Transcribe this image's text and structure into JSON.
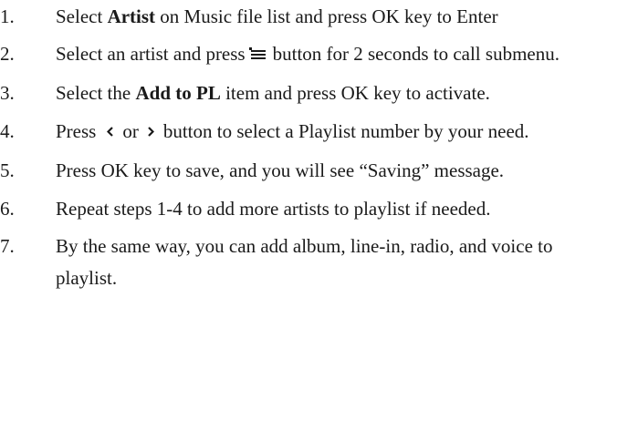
{
  "steps": [
    {
      "number": "1.",
      "before": "Select ",
      "bold": "Artist",
      "after": " on Music file list and press OK key to Enter"
    },
    {
      "number": "2.",
      "before": "Select an artist and press",
      "icon": "menu-list-icon",
      "after": "button for 2 seconds to call submenu."
    },
    {
      "number": "3.",
      "before": "Select the ",
      "bold": "Add to PL",
      "after": " item and press OK key to activate."
    },
    {
      "number": "4.",
      "before": "Press",
      "icon_left": "chevron-left-icon",
      "middle": "or",
      "icon_right": "chevron-right-icon",
      "after": "button to select a Playlist number by your need."
    },
    {
      "number": "5.",
      "text": "Press OK key to save, and you will see “Saving” message."
    },
    {
      "number": "6.",
      "text": "Repeat steps 1-4 to add more artists to playlist if needed."
    },
    {
      "number": "7.",
      "text": "By the same way, you can add album, line-in, radio, and voice to playlist."
    }
  ]
}
